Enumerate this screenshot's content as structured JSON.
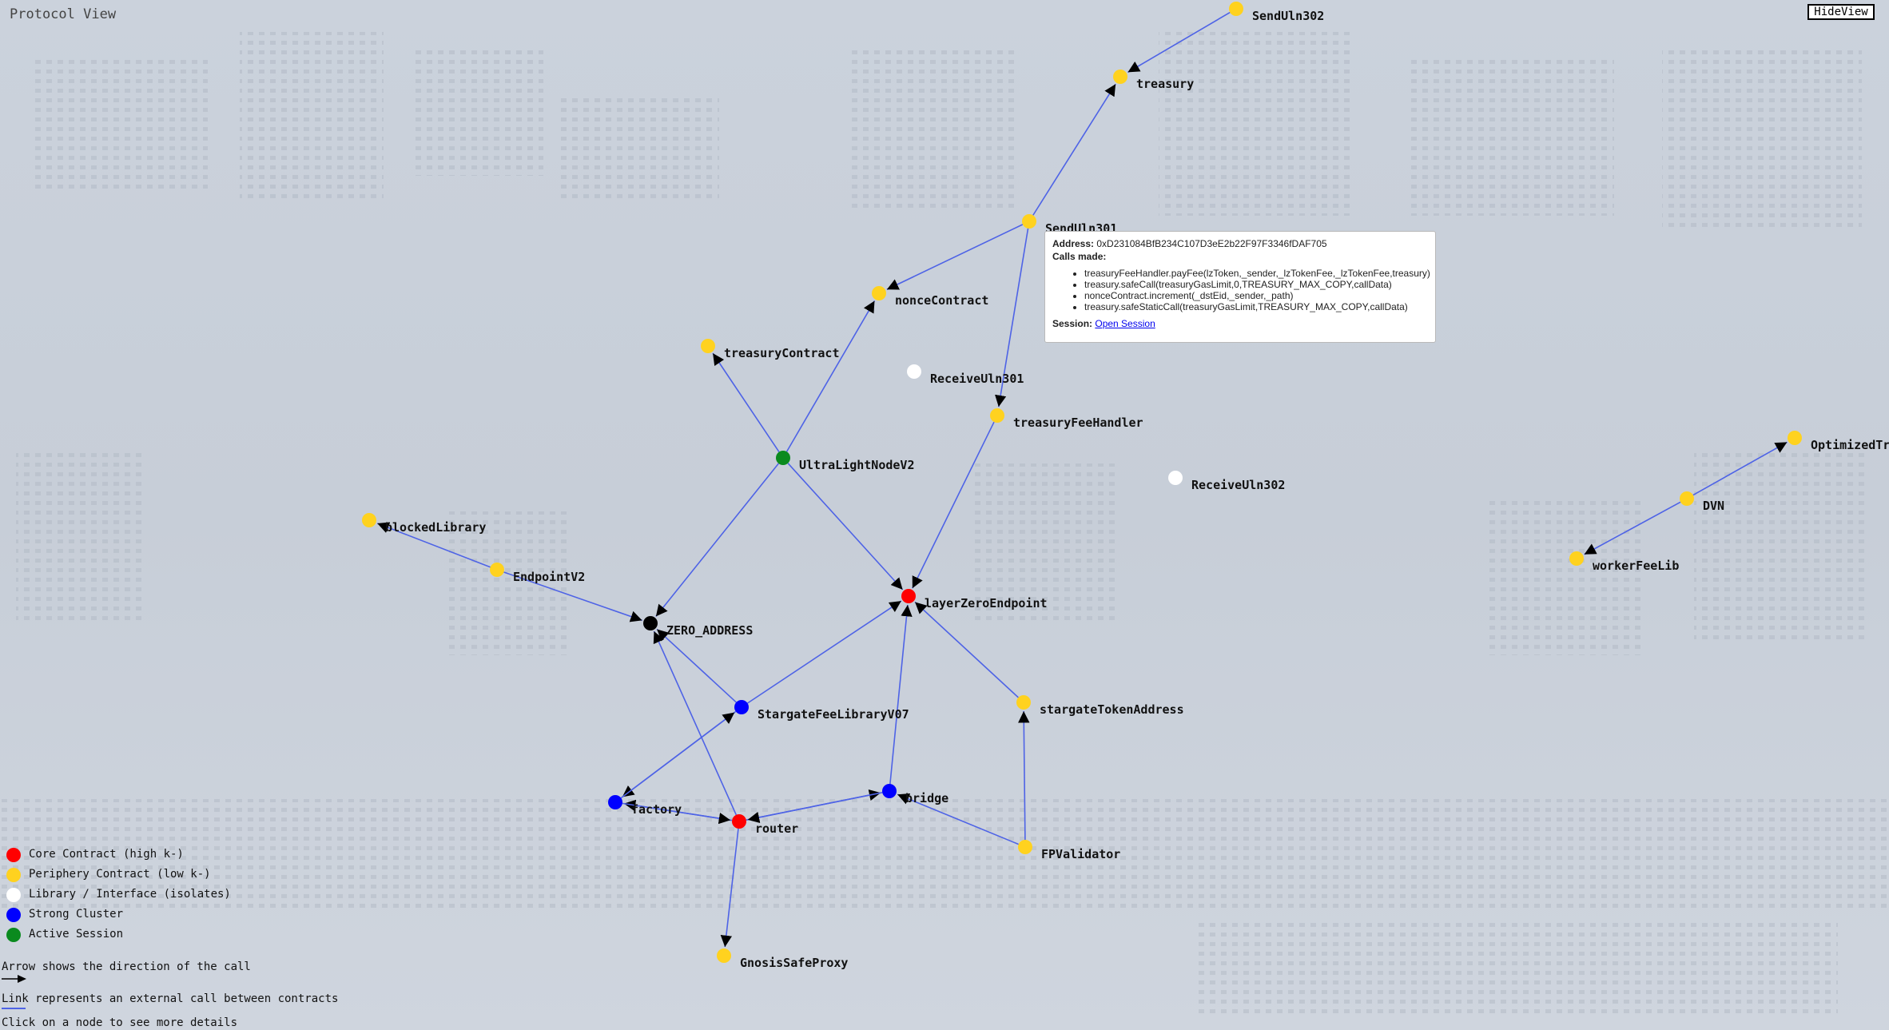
{
  "header": {
    "title": "Protocol View",
    "hide_button": "HideView"
  },
  "colors": {
    "core": "#ff0000",
    "periphery": "#ffd21f",
    "library": "#ffffff",
    "cluster": "#0000ff",
    "session": "#0a8a1e",
    "zero": "#000000",
    "link": "#4e63e6"
  },
  "nodes": [
    {
      "id": "SendUln302",
      "label": "SendUln302",
      "type": "periphery"
    },
    {
      "id": "treasury",
      "label": "treasury",
      "type": "periphery"
    },
    {
      "id": "SendUln301",
      "label": "SendUln301",
      "type": "periphery"
    },
    {
      "id": "nonceContract",
      "label": "nonceContract",
      "type": "periphery"
    },
    {
      "id": "treasuryContract",
      "label": "treasuryContract",
      "type": "periphery"
    },
    {
      "id": "ReceiveUln301",
      "label": "ReceiveUln301",
      "type": "library"
    },
    {
      "id": "treasuryFeeHandler",
      "label": "treasuryFeeHandler",
      "type": "periphery"
    },
    {
      "id": "UltraLightNodeV2",
      "label": "UltraLightNodeV2",
      "type": "session"
    },
    {
      "id": "ReceiveUln302",
      "label": "ReceiveUln302",
      "type": "library"
    },
    {
      "id": "OptimizedTransfer",
      "label": "OptimizedTra",
      "type": "periphery"
    },
    {
      "id": "DVN",
      "label": "DVN",
      "type": "periphery"
    },
    {
      "id": "workerFeeLib",
      "label": "workerFeeLib",
      "type": "periphery"
    },
    {
      "id": "blockedLibrary",
      "label": "blockedLibrary",
      "type": "periphery"
    },
    {
      "id": "EndpointV2",
      "label": "EndpointV2",
      "type": "periphery"
    },
    {
      "id": "ZERO_ADDRESS",
      "label": "ZERO_ADDRESS",
      "type": "zero"
    },
    {
      "id": "layerZeroEndpoint",
      "label": "layerZeroEndpoint",
      "type": "core"
    },
    {
      "id": "StargateFeeLibraryV07",
      "label": "StargateFeeLibraryV07",
      "type": "cluster"
    },
    {
      "id": "stargateTokenAddress",
      "label": "stargateTokenAddress",
      "type": "periphery"
    },
    {
      "id": "factory",
      "label": "factory",
      "type": "cluster"
    },
    {
      "id": "router",
      "label": "router",
      "type": "core"
    },
    {
      "id": "bridge",
      "label": "bridge",
      "type": "cluster"
    },
    {
      "id": "FPValidator",
      "label": "FPValidator",
      "type": "periphery"
    },
    {
      "id": "GnosisSafeProxy",
      "label": "GnosisSafeProxy",
      "type": "periphery"
    }
  ],
  "links": [
    [
      "SendUln302",
      "treasury"
    ],
    [
      "SendUln301",
      "treasury"
    ],
    [
      "SendUln301",
      "nonceContract"
    ],
    [
      "SendUln301",
      "treasuryFeeHandler"
    ],
    [
      "UltraLightNodeV2",
      "nonceContract"
    ],
    [
      "UltraLightNodeV2",
      "treasuryContract"
    ],
    [
      "UltraLightNodeV2",
      "ZERO_ADDRESS"
    ],
    [
      "UltraLightNodeV2",
      "layerZeroEndpoint"
    ],
    [
      "treasuryFeeHandler",
      "layerZeroEndpoint"
    ],
    [
      "EndpointV2",
      "blockedLibrary"
    ],
    [
      "EndpointV2",
      "ZERO_ADDRESS"
    ],
    [
      "DVN",
      "OptimizedTransfer"
    ],
    [
      "DVN",
      "workerFeeLib"
    ],
    [
      "StargateFeeLibraryV07",
      "ZERO_ADDRESS"
    ],
    [
      "StargateFeeLibraryV07",
      "layerZeroEndpoint"
    ],
    [
      "StargateFeeLibraryV07",
      "factory"
    ],
    [
      "factory",
      "StargateFeeLibraryV07"
    ],
    [
      "stargateTokenAddress",
      "layerZeroEndpoint"
    ],
    [
      "router",
      "ZERO_ADDRESS"
    ],
    [
      "router",
      "factory"
    ],
    [
      "factory",
      "router"
    ],
    [
      "router",
      "bridge"
    ],
    [
      "bridge",
      "router"
    ],
    [
      "bridge",
      "layerZeroEndpoint"
    ],
    [
      "FPValidator",
      "bridge"
    ],
    [
      "FPValidator",
      "stargateTokenAddress"
    ],
    [
      "router",
      "GnosisSafeProxy"
    ]
  ],
  "tooltip": {
    "address_label": "Address:",
    "address": "0xD231084BfB234C107D3eE2b22F97F3346fDAF705",
    "calls_label": "Calls made:",
    "calls": [
      "treasuryFeeHandler.payFee(lzToken,_sender,_lzTokenFee,_lzTokenFee,treasury)",
      "treasury.safeCall(treasuryGasLimit,0,TREASURY_MAX_COPY,callData)",
      "nonceContract.increment(_dstEid,_sender,_path)",
      "treasury.safeStaticCall(treasuryGasLimit,TREASURY_MAX_COPY,callData)"
    ],
    "session_label": "Session:",
    "session_link": "Open Session"
  },
  "legend": {
    "items": [
      {
        "label": "Core Contract (high k-)",
        "color": "#ff0000"
      },
      {
        "label": "Periphery Contract (low k-)",
        "color": "#ffd21f"
      },
      {
        "label": "Library / Interface (isolates)",
        "color": "#ffffff"
      },
      {
        "label": "Strong Cluster",
        "color": "#0000ff"
      },
      {
        "label": "Active Session",
        "color": "#0a8a1e"
      }
    ],
    "arrow_text": "Arrow shows the direction of the call",
    "link_text": "Link represents an external call between contracts",
    "click_text": "Click on a node to see more details"
  }
}
